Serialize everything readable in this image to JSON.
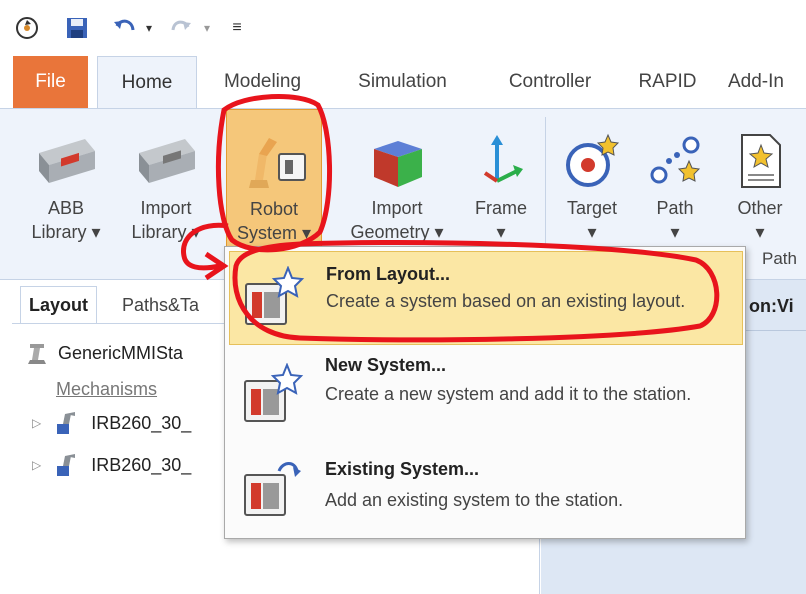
{
  "quick_access": {
    "icons": [
      "refresh-icon",
      "save-icon",
      "undo-icon",
      "dropdown-arrow-icon",
      "redo-icon",
      "dropdown-arrow-icon",
      "customize-toolbar-icon"
    ]
  },
  "tabs": [
    {
      "label": "File"
    },
    {
      "label": "Home"
    },
    {
      "label": "Modeling"
    },
    {
      "label": "Simulation"
    },
    {
      "label": "Controller"
    },
    {
      "label": "RAPID"
    },
    {
      "label": "Add-In"
    }
  ],
  "ribbon": {
    "buttons": [
      {
        "line1": "ABB",
        "line2": "Library ▾"
      },
      {
        "line1": "Import",
        "line2": "Library ▾"
      },
      {
        "line1": "Robot",
        "line2": "System ▾"
      },
      {
        "line1": "Import",
        "line2": "Geometry ▾"
      },
      {
        "line1": "Frame",
        "line2": "▾"
      },
      {
        "line1": "Target",
        "line2": "▾"
      },
      {
        "line1": "Path",
        "line2": "▾"
      },
      {
        "line1": "Other",
        "line2": "▾"
      }
    ],
    "group_label_path": "Path"
  },
  "left_pane": {
    "tabs": [
      "Layout",
      "Paths&Ta"
    ],
    "tree": {
      "station": "GenericMMISta",
      "mechanisms_label": "Mechanisms",
      "robots": [
        "IRB260_30_",
        "IRB260_30_"
      ]
    }
  },
  "right_pane": {
    "title": "on:Vi"
  },
  "robot_system_menu": {
    "items": [
      {
        "title": "From Layout...",
        "desc": "Create a system based on an existing layout.",
        "highlighted": true
      },
      {
        "title": "New System...",
        "desc": "Create a new system and add it to the station.",
        "highlighted": false
      },
      {
        "title": "Existing System...",
        "desc": "Add an existing system to the station.",
        "highlighted": false
      }
    ]
  },
  "colors": {
    "file_tab": "#e9753a",
    "ribbon_bg": "#eef3fb",
    "active_button": "#f5c77a",
    "menu_highlight": "#fbe7a4",
    "annotation": "#e8141c"
  }
}
